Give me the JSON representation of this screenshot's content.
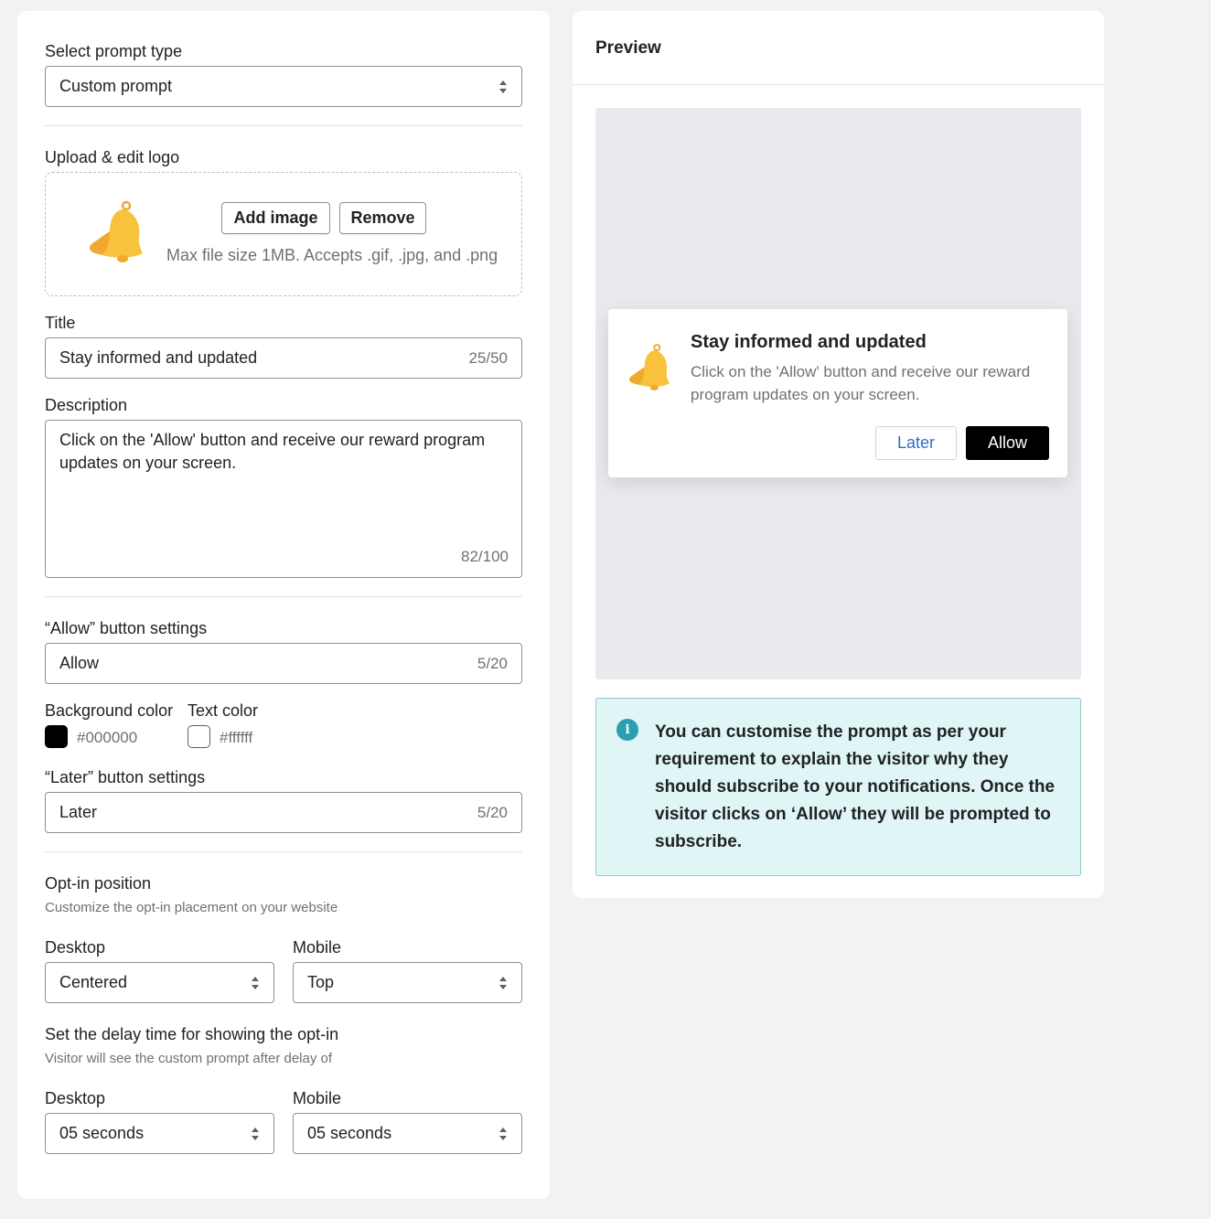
{
  "settings": {
    "prompt_type": {
      "label": "Select prompt type",
      "value": "Custom prompt"
    },
    "logo": {
      "label": "Upload & edit logo",
      "add_label": "Add image",
      "remove_label": "Remove",
      "help": "Max file size 1MB. Accepts .gif, .jpg, and .png",
      "icon": "bell-icon"
    },
    "title": {
      "label": "Title",
      "value": "Stay informed and updated",
      "count": "25/50"
    },
    "description": {
      "label": "Description",
      "value": "Click on the 'Allow' button and receive our reward program updates on your screen.",
      "count": "82/100"
    },
    "allow_button": {
      "label": "“Allow” button settings",
      "value": "Allow",
      "count": "5/20",
      "bg_label": "Background color",
      "bg_value": "#000000",
      "text_label": "Text color",
      "text_value": "#ffffff"
    },
    "later_button": {
      "label": "“Later” button settings",
      "value": "Later",
      "count": "5/20"
    },
    "position": {
      "heading": "Opt-in position",
      "subheading": "Customize the opt-in placement on your website",
      "desktop_label": "Desktop",
      "desktop_value": "Centered",
      "mobile_label": "Mobile",
      "mobile_value": "Top"
    },
    "delay": {
      "heading": "Set the delay time for showing the opt-in",
      "subheading": "Visitor will see the custom prompt after delay of",
      "desktop_label": "Desktop",
      "desktop_value": "05 seconds",
      "mobile_label": "Mobile",
      "mobile_value": "05 seconds"
    }
  },
  "preview": {
    "heading": "Preview",
    "popup_title": "Stay informed and updated",
    "popup_description": "Click on the 'Allow' button and receive our reward program updates on your screen.",
    "later_label": "Later",
    "allow_label": "Allow",
    "info_text": "You can customise the prompt as per your requirement to explain the visitor why they should subscribe to your notifications. Once the visitor clicks on ‘Allow’ they will be prompted to subscribe.",
    "info_icon": "info-icon"
  },
  "colors": {
    "allow_bg": "#000000",
    "allow_text": "#ffffff",
    "bell": "#f9c23c",
    "info_accent": "#2a9fb0"
  }
}
